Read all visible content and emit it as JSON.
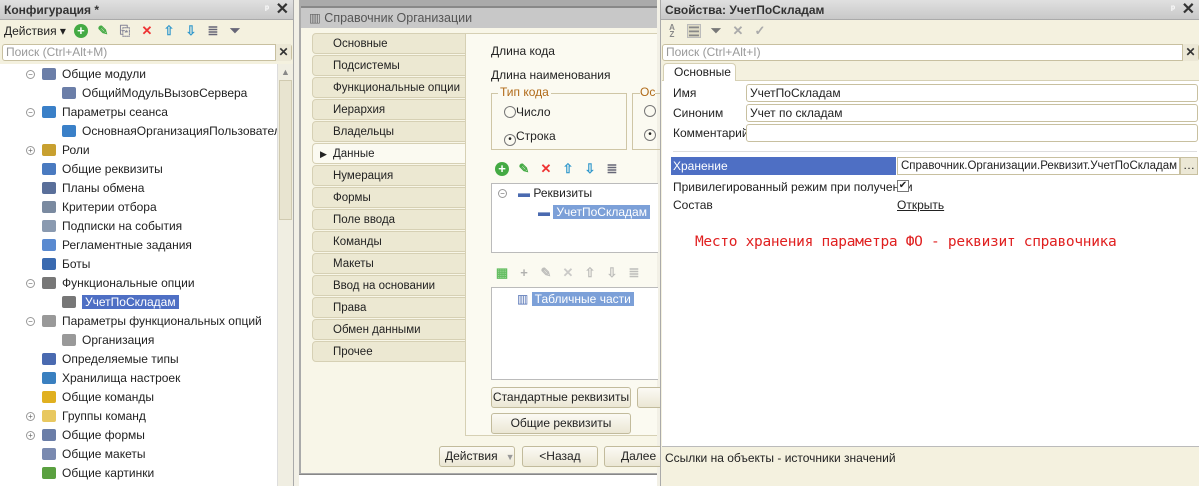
{
  "config_panel": {
    "title": "Конфигурация *",
    "actions_label": "Действия",
    "search_placeholder": "Поиск (Ctrl+Alt+M)",
    "tree": [
      {
        "label": "Общие модули",
        "level": 0,
        "toggle": "−",
        "icon": "module-icon",
        "color": "#6b7ea8"
      },
      {
        "label": "ОбщийМодульВызовСервера",
        "level": 1,
        "icon": "module-icon",
        "color": "#6b7ea8"
      },
      {
        "label": "Параметры сеанса",
        "level": 0,
        "toggle": "−",
        "icon": "diamond-icon",
        "color": "#3a80c8"
      },
      {
        "label": "ОсновнаяОрганизацияПользователя",
        "level": 1,
        "icon": "diamond-icon",
        "color": "#3a80c8"
      },
      {
        "label": "Роли",
        "level": 0,
        "toggle": "+",
        "icon": "key-icon",
        "color": "#c8a030"
      },
      {
        "label": "Общие реквизиты",
        "level": 0,
        "icon": "attribute-icon",
        "color": "#4a7ac0"
      },
      {
        "label": "Планы обмена",
        "level": 0,
        "icon": "exchange-icon",
        "color": "#5a6f9a"
      },
      {
        "label": "Критерии отбора",
        "level": 0,
        "icon": "filter-icon",
        "color": "#7a8aa0"
      },
      {
        "label": "Подписки на события",
        "level": 0,
        "icon": "event-icon",
        "color": "#8a9ab0"
      },
      {
        "label": "Регламентные задания",
        "level": 0,
        "icon": "clock-icon",
        "color": "#5a8ad0"
      },
      {
        "label": "Боты",
        "level": 0,
        "icon": "bot-icon",
        "color": "#3a6ab0"
      },
      {
        "label": "Функциональные опции",
        "level": 0,
        "toggle": "−",
        "icon": "options-icon",
        "color": "#777"
      },
      {
        "label": "УчетПоСкладам",
        "level": 1,
        "icon": "options-icon",
        "color": "#777",
        "selected": true
      },
      {
        "label": "Параметры функциональных опций",
        "level": 0,
        "toggle": "−",
        "icon": "params-icon",
        "color": "#999"
      },
      {
        "label": "Организация",
        "level": 1,
        "icon": "params-icon",
        "color": "#999"
      },
      {
        "label": "Определяемые типы",
        "level": 0,
        "icon": "types-icon",
        "color": "#4a6ab0"
      },
      {
        "label": "Хранилища настроек",
        "level": 0,
        "icon": "storage-icon",
        "color": "#3a80c0"
      },
      {
        "label": "Общие команды",
        "level": 0,
        "icon": "command-icon",
        "color": "#e0b020"
      },
      {
        "label": "Группы команд",
        "level": 0,
        "toggle": "+",
        "icon": "folder-icon",
        "color": "#e8c860"
      },
      {
        "label": "Общие формы",
        "level": 0,
        "toggle": "+",
        "icon": "form-icon",
        "color": "#6b7ea8"
      },
      {
        "label": "Общие макеты",
        "level": 0,
        "icon": "template-icon",
        "color": "#7a8ab0"
      },
      {
        "label": "Общие картинки",
        "level": 0,
        "icon": "picture-icon",
        "color": "#5aa040"
      }
    ]
  },
  "catalog_window": {
    "title": "Справочник Организации",
    "tabs": [
      "Основные",
      "Подсистемы",
      "Функциональные опции",
      "Иерархия",
      "Владельцы",
      "Данные",
      "Нумерация",
      "Формы",
      "Поле ввода",
      "Команды",
      "Макеты",
      "Ввод на основании",
      "Права",
      "Обмен данными",
      "Прочее"
    ],
    "active_tab": "Данные",
    "code_length_label": "Длина кода",
    "name_length_label": "Длина наименования",
    "code_type_label": "Тип кода",
    "code_type_other_label": "Ос",
    "radio_number": "Число",
    "radio_string": "Строка",
    "attributes_root": "Реквизиты",
    "attribute_item": "УчетПоСкладам",
    "tabular_parts": "Табличные части",
    "btn_standard": "Стандартные реквизиты",
    "btn_common": "Общие реквизиты",
    "btn_actions": "Действия",
    "btn_back": "<Назад",
    "btn_next": "Далее"
  },
  "properties_panel": {
    "title": "Свойства: УчетПоСкладам",
    "search_placeholder": "Поиск (Ctrl+Alt+I)",
    "tab": "Основные",
    "name_label": "Имя",
    "name_value": "УчетПоСкладам",
    "synonym_label": "Синоним",
    "synonym_value": "Учет по складам",
    "comment_label": "Комментарий",
    "comment_value": "",
    "storage_label": "Хранение",
    "storage_value": "Справочник.Организации.Реквизит.УчетПоСкладам",
    "privileged_label": "Привилегированный режим при получении",
    "privileged_checked": true,
    "content_label": "Состав",
    "content_link": "Открыть",
    "annotation": "Место хранения параметра ФО - реквизит справочника",
    "description": "Ссылки на объекты - источники значений"
  }
}
